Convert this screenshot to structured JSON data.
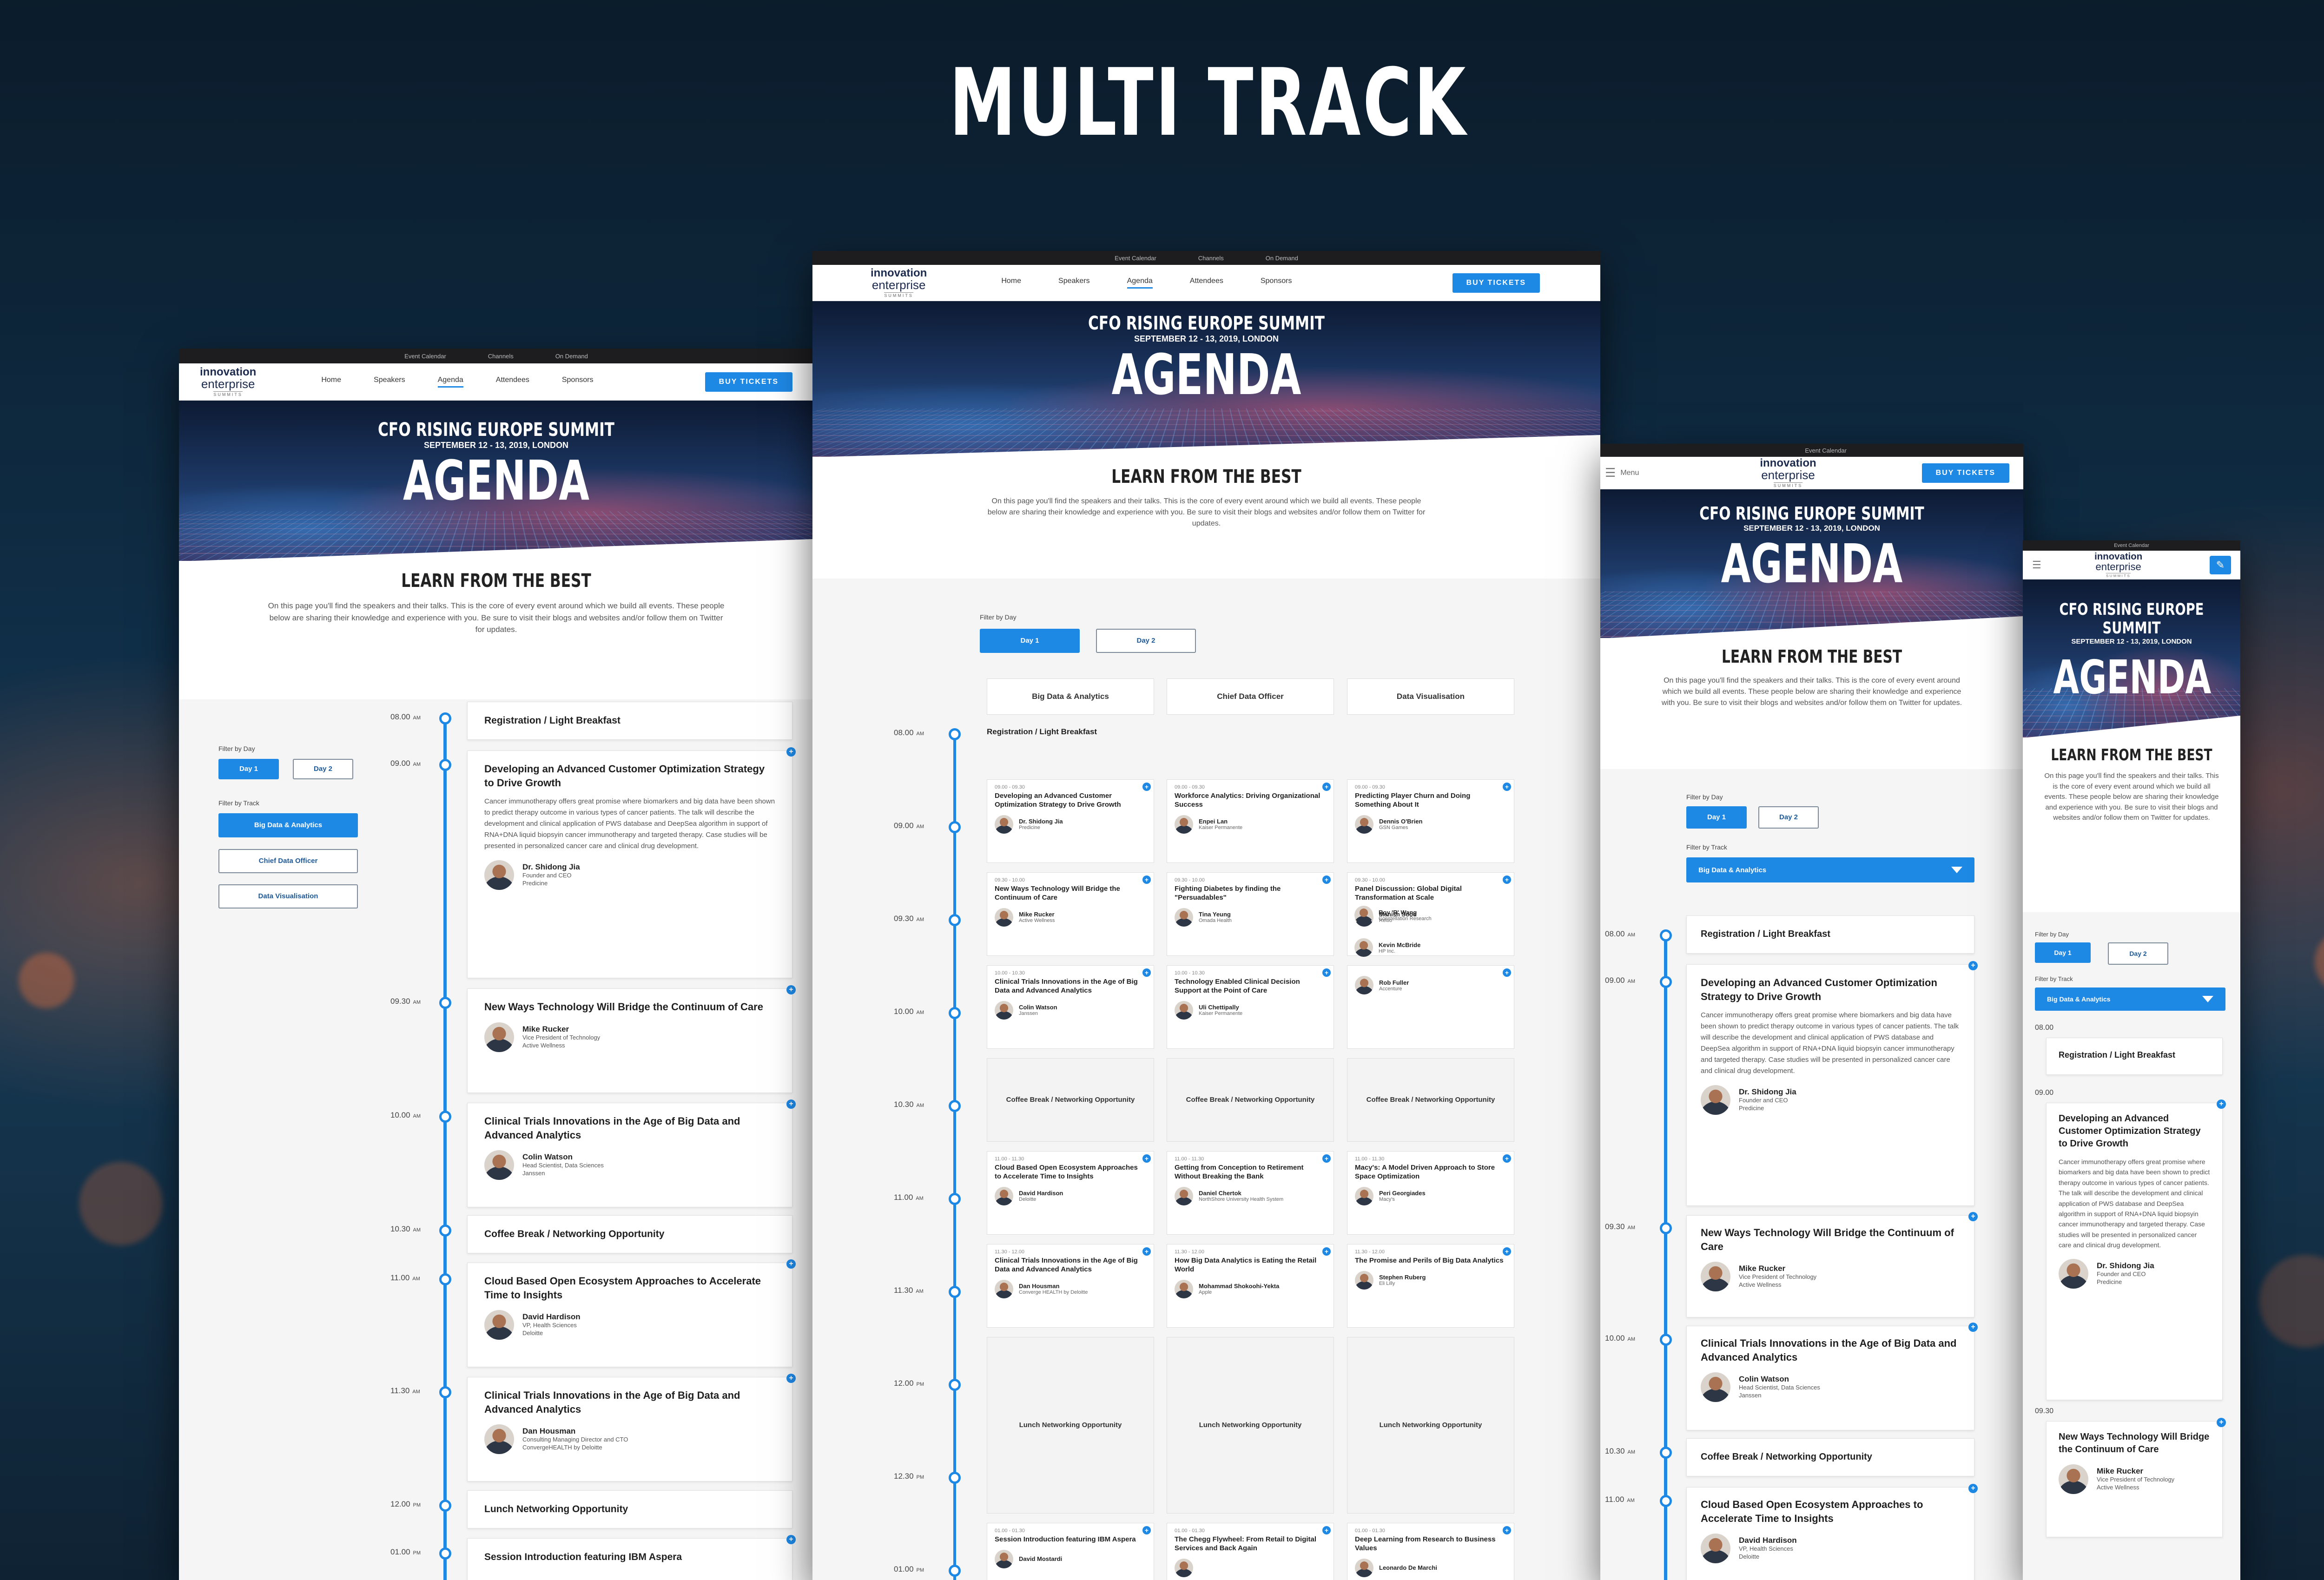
{
  "headline": "MULTI TRACK",
  "util": {
    "event_calendar": "Event Calendar",
    "channels": "Channels",
    "on_demand": "On Demand"
  },
  "logo": {
    "l1": "innovation",
    "l2": "enterprise",
    "l3": "SUMMITS"
  },
  "nav": [
    "Home",
    "Speakers",
    "Agenda",
    "Attendees",
    "Sponsors"
  ],
  "menu_label": "Menu",
  "buy": "BUY TICKETS",
  "hero": {
    "event": "CFO RISING EUROPE SUMMIT",
    "date": "SEPTEMBER 12 - 13, 2019, LONDON",
    "title": "AGENDA"
  },
  "learn": {
    "title": "LEARN FROM THE BEST",
    "text": "On this page you'll find the speakers and their talks. This is the core of every event around which we build all events. These people below are sharing their knowledge and experience with you. Be sure to visit their blogs and websites and/or follow them on Twitter for updates."
  },
  "filters": {
    "by_day": "Filter by Day",
    "by_track": "Filter by Track",
    "day1": "Day 1",
    "day2": "Day 2",
    "tracks": [
      "Big Data & Analytics",
      "Chief Data Officer",
      "Data Visualisation"
    ]
  },
  "am": "AM",
  "pm": "PM",
  "sessions": [
    {
      "time": "08.00",
      "title": "Registration / Light Breakfast"
    },
    {
      "time": "09.00",
      "title": "Developing an Advanced Customer Optimization Strategy to Drive Growth",
      "desc": "Cancer immunotherapy offers great promise where biomarkers and big data have been shown to predict therapy outcome in various types of cancer patients. The talk will describe the development and clinical application of PWS database and DeepSea algorithm in support of RNA+DNA liquid biopsyin cancer immunotherapy and targeted therapy. Case studies will be presented in personalized cancer care and clinical drug development.",
      "speaker": "Dr. Shidong Jia",
      "role": "Founder and CEO",
      "org": "Predicine"
    },
    {
      "time": "09.30",
      "title": "New Ways Technology Will Bridge the Continuum of Care",
      "speaker": "Mike Rucker",
      "role": "Vice President of Technology",
      "org": "Active Wellness"
    },
    {
      "time": "10.00",
      "title": "Clinical Trials Innovations in the Age of Big Data and Advanced Analytics",
      "speaker": "Colin Watson",
      "role": "Head Scientist, Data Sciences",
      "org": "Janssen"
    },
    {
      "time": "10.30",
      "title": "Coffee Break / Networking Opportunity"
    },
    {
      "time": "11.00",
      "title": "Cloud Based Open Ecosystem Approaches to Accelerate Time to Insights",
      "speaker": "David Hardison",
      "role": "VP, Health Sciences",
      "org": "Deloitte"
    },
    {
      "time": "11.30",
      "title": "Clinical Trials Innovations in the Age of Big Data and Advanced Analytics",
      "speaker": "Dan Housman",
      "role": "Consulting Managing Director and CTO",
      "org": "ConvergeHEALTH by Deloitte"
    },
    {
      "time": "12.00",
      "title": "Lunch Networking Opportunity"
    },
    {
      "time": "01.00",
      "title": "Session Introduction featuring IBM Aspera"
    }
  ],
  "multi": {
    "columns": [
      "Big Data & Analytics",
      "Chief Data Officer",
      "Data Visualisation"
    ],
    "times": [
      "08.00",
      "09.00",
      "09.30",
      "10.00",
      "10.30",
      "11.00",
      "11.30",
      "12.00",
      "12.30",
      "01.00"
    ],
    "registration": "Registration / Light Breakfast",
    "rows": [
      [
        {
          "t": "09.00 - 09.30",
          "h": "Developing an Advanced Customer Optimization Strategy to Drive Growth",
          "n": "Dr. Shidong Jia",
          "o": "Predicine"
        },
        {
          "t": "09.00 - 09.30",
          "h": "Workforce Analytics: Driving Organizational Success",
          "n": "Enpei Lan",
          "o": "Kaiser Permanente"
        },
        {
          "t": "09.00 - 09.30",
          "h": "Predicting Player Churn and Doing Something About It",
          "n": "Dennis O'Brien",
          "o": "GSN Games"
        }
      ],
      [
        {
          "t": "09.30 - 10.00",
          "h": "New Ways Technology Will Bridge the Continuum of Care",
          "n": "Mike Rucker",
          "o": "Active Wellness"
        },
        {
          "t": "09.30 - 10.00",
          "h": "Fighting Diabetes by finding the \"Persuadables\"",
          "n": "Tina Yeung",
          "o": "Omada Health"
        },
        {
          "t": "09.30 - 10.00",
          "h": "Panel Discussion: Global Digital Transformation at Scale",
          "n": "Manish Sood",
          "o": "Reltio"
        }
      ],
      [
        {
          "t": "10.00 - 10.30",
          "h": "Clinical Trials Innovations in the Age of Big Data and Advanced Analytics",
          "n": "Colin Watson",
          "o": "Janssen"
        },
        {
          "t": "10.00 - 10.30",
          "h": "Technology Enabled Clinical Decision Support at the Point of Care",
          "n": "Uli Chettipally",
          "o": "Kaiser Permanente"
        },
        {
          "t": "",
          "h": "",
          "n": "Rob Fuller",
          "o": "Accenture"
        }
      ],
      [
        {
          "break": "Coffee Break / Networking Opportunity"
        },
        {
          "break": "Coffee Break / Networking Opportunity"
        },
        {
          "break": "Coffee Break / Networking Opportunity"
        }
      ],
      [
        {
          "t": "11.00 - 11.30",
          "h": "Cloud Based Open Ecosystem Approaches to Accelerate Time to Insights",
          "n": "David Hardison",
          "o": "Deloitte"
        },
        {
          "t": "11.00 - 11.30",
          "h": "Getting from Conception to Retirement Without Breaking the Bank",
          "n": "Daniel Chertok",
          "o": "NorthShore University Health System"
        },
        {
          "t": "11.00 - 11.30",
          "h": "Macy's: A Model Driven Approach to Store Space Optimization",
          "n": "Peri Georgiades",
          "o": "Macy's"
        }
      ],
      [
        {
          "t": "11.30 - 12.00",
          "h": "Clinical Trials Innovations in the Age of Big Data and Advanced Analytics",
          "n": "Dan Housman",
          "o": "Converge HEALTH by Deloitte"
        },
        {
          "t": "11.30 - 12.00",
          "h": "How Big Data Analytics is Eating the Retail World",
          "n": "Mohammad Shokoohi-Yekta",
          "o": "Apple"
        },
        {
          "t": "11.30 - 12.00",
          "h": "The Promise and Perils of Big Data Analytics",
          "n": "Stephen Ruberg",
          "o": "Eli Lilly"
        }
      ],
      [
        {
          "break": "Lunch Networking Opportunity"
        },
        {
          "break": "Lunch Networking Opportunity"
        },
        {
          "break": "Lunch Networking Opportunity"
        }
      ],
      [
        {
          "t": "01.00 - 01.30",
          "h": "Session Introduction featuring IBM Aspera",
          "n": "David Mostardi",
          "o": ""
        },
        {
          "t": "01.00 - 01.30",
          "h": "The Chegg Flywheel: From Retail to Digital Services and Back Again",
          "n": "",
          "o": ""
        },
        {
          "t": "01.00 - 01.30",
          "h": "Deep Learning from Research to Business Values",
          "n": "Leonardo De Marchi",
          "o": ""
        }
      ]
    ],
    "extra_speakers": [
      {
        "n": "Roy 'R' Wang",
        "o": "Constellation Research"
      },
      {
        "n": "Kevin McBride",
        "o": "HP Inc."
      }
    ]
  }
}
